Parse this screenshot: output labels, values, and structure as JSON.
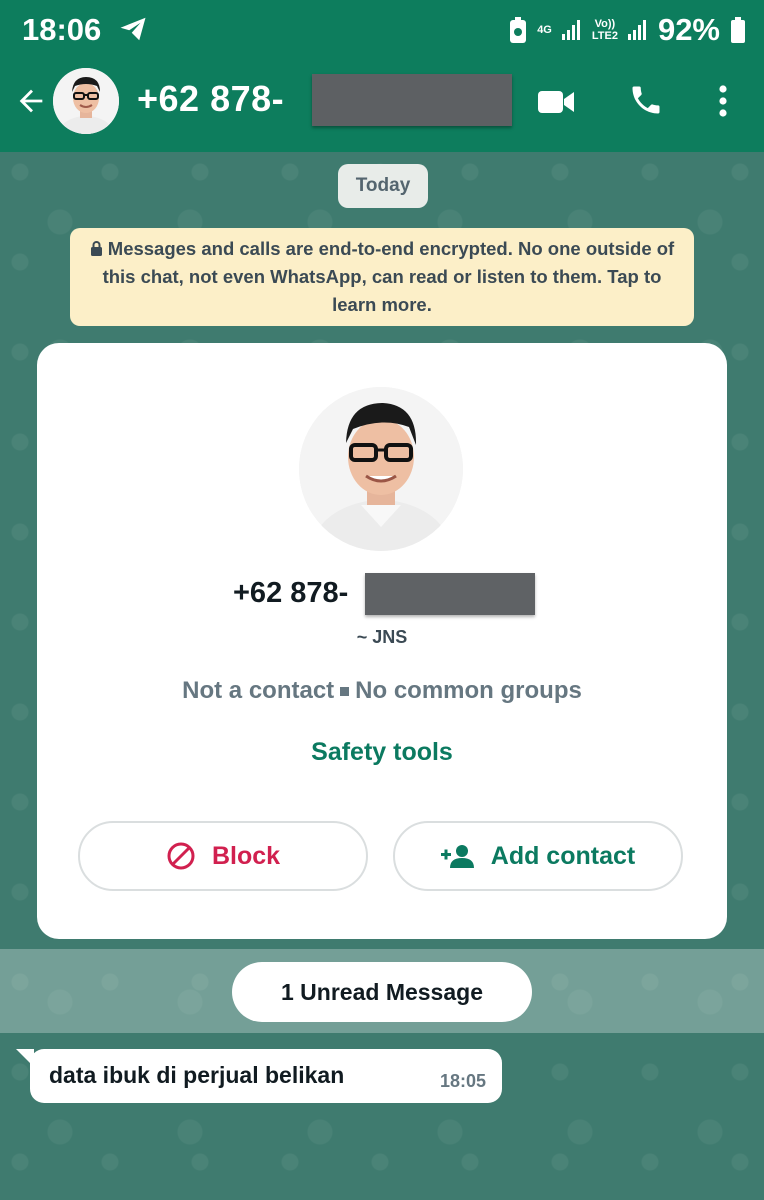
{
  "status_bar": {
    "time": "18:06",
    "network": "4G",
    "volte": "Vo))",
    "lte": "LTE2",
    "battery": "92%"
  },
  "header": {
    "title": "+62 878-",
    "icons": [
      "back-arrow-icon",
      "video-call-icon",
      "voice-call-icon",
      "more-options-icon"
    ]
  },
  "chat": {
    "date_label": "Today",
    "encryption_notice": "Messages and calls are end-to-end encrypted. No one outside of this chat, not even WhatsApp, can read or listen to them. Tap to learn more.",
    "profile_card": {
      "number": "+62 878-",
      "pushname": "~ JNS",
      "status_left": "Not a contact",
      "status_right": "No common groups",
      "safety_link": "Safety tools",
      "block_label": "Block",
      "add_contact_label": "Add contact"
    },
    "unread_label": "1 Unread Message",
    "messages": [
      {
        "text": "data ibuk di perjual belikan",
        "time": "18:05"
      }
    ]
  },
  "colors": {
    "header_green": "#0d7d5d",
    "accent_green": "#0b7a60",
    "block_red": "#d1204f",
    "notice_yellow": "#fcefc8"
  }
}
